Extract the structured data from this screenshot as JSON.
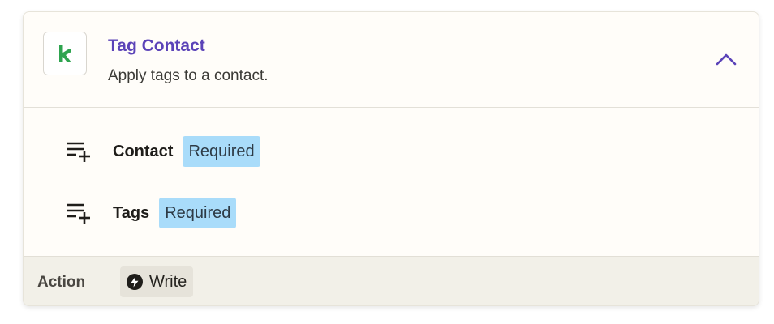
{
  "step": {
    "title": "Tag Contact",
    "subtitle": "Apply tags to a contact.",
    "app_icon": "keap-k-logo",
    "collapse_icon": "chevron-up-icon"
  },
  "fields": [
    {
      "label": "Contact",
      "badge": "Required",
      "icon": "list-add-icon"
    },
    {
      "label": "Tags",
      "badge": "Required",
      "icon": "list-add-icon"
    }
  ],
  "footer": {
    "label": "Action",
    "type_label": "Write",
    "type_icon": "bolt-icon"
  },
  "colors": {
    "title": "#5b43b8",
    "required_badge_bg": "#a9dcfa",
    "logo_green": "#2ea44f"
  }
}
